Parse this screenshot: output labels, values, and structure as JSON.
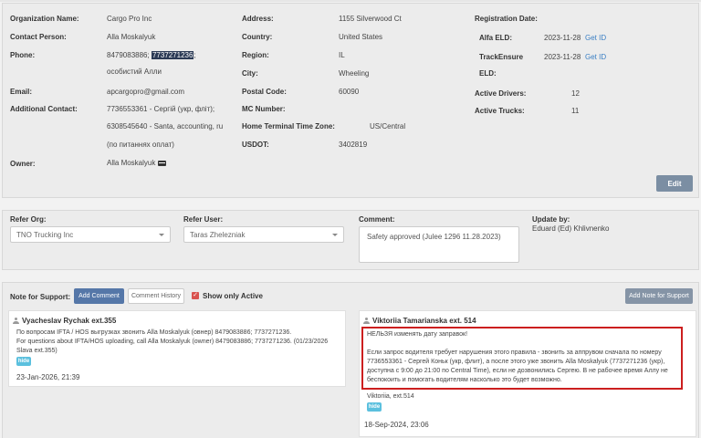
{
  "org": {
    "org_name_label": "Organization Name:",
    "org_name": "Cargo Pro Inc",
    "contact_label": "Contact Person:",
    "contact": "Alla Moskalyuk",
    "phone_label": "Phone:",
    "phone_a": "8479083886;",
    "phone_b": "7737271236",
    "phone_c": ";",
    "phone_note": "особистий Алли",
    "email_label": "Email:",
    "email": "apcargopro@gmail.com",
    "additional_label": "Additional Contact:",
    "additional_1": "7736553361 - Сергій (укр, фліт);",
    "additional_2": "6308545640 - Santa, accounting, ru",
    "additional_3": "(по питаннях оплат)",
    "owner_label": "Owner:",
    "owner": "Alla Moskalyuk",
    "address_label": "Address:",
    "address": "1155 Silverwood Ct",
    "country_label": "Country:",
    "country": "United States",
    "region_label": "Region:",
    "region": "IL",
    "city_label": "City:",
    "city": "Wheeling",
    "postal_label": "Postal Code:",
    "postal": "60090",
    "mc_label": "MC Number:",
    "mc": "",
    "terminal_tz_label": "Home Terminal Time Zone:",
    "terminal_tz": "US/Central",
    "usdot_label": "USDOT:",
    "usdot": "3402819",
    "reg_date_label": "Registration Date:",
    "alfa_label": "Alfa ELD:",
    "alfa_date": "2023-11-28",
    "alfa_link": "Get ID",
    "trackensure_label_1": "TrackEnsure",
    "trackensure_label_2": "ELD:",
    "trackensure_date": "2023-11-28",
    "trackensure_link": "Get ID",
    "drivers_label": "Active Drivers:",
    "drivers": "12",
    "trucks_label": "Active Trucks:",
    "trucks": "11",
    "edit_label": "Edit"
  },
  "refer": {
    "org_label": "Refer Org:",
    "org_value": "TNO Trucking Inc",
    "user_label": "Refer User:",
    "user_value": "Taras Zhelezniak",
    "comment_label": "Comment:",
    "comment_value": "Safety approved (Julee 1296 11.28.2023)",
    "update_label": "Update by:",
    "update_value": "Eduard (Ed) Khlivnenko"
  },
  "support": {
    "title": "Note for Support:",
    "add_comment": "Add Comment",
    "comment_history": "Comment History",
    "show_only_active": "Show only Active",
    "add_note": "Add Note for Support",
    "notes": [
      {
        "author": "Vyacheslav Rychak ext.355",
        "line1": "По вопросам IFTA / HOS выгрузках звонить Alla Moskalyuk (овнер) 8479083886; 7737271236.",
        "line2": "For questions about IFTA/HOS uploading, call Alla Moskalyuk (owner) 8479083886; 7737271236. (01/23/2026",
        "line3": "Slava ext.355)",
        "hide": "hide",
        "date": "23-Jan-2026, 21:39"
      },
      {
        "author": "Viktoriia Tamarianska ext. 514",
        "warn": "НЕЛЬЗЯ изменять дату заправок!",
        "body": "Если запрос водителя требует нарушения этого правила - звонить за аппрувом сначала по номеру 7736553361 - Сергей Коньк (укр, флит), а после этого уже звонить Alla Moskalyuk (7737271236 (укр), доступна с 9:00 до 21:00 по Central Time), если не дозвонились Сергею. В не рабочее время Аллу не беспокоить и помогать водителям насколько это будет возможно.",
        "signature": "Viktoriia, ext.514",
        "hide": "hide",
        "date": "18-Sep-2024, 23:06"
      }
    ]
  },
  "colors": {
    "accent": "#5577a8",
    "highlight_border": "#cc1f1f",
    "badge": "#5bc0de",
    "checkbox": "#d9534f"
  }
}
